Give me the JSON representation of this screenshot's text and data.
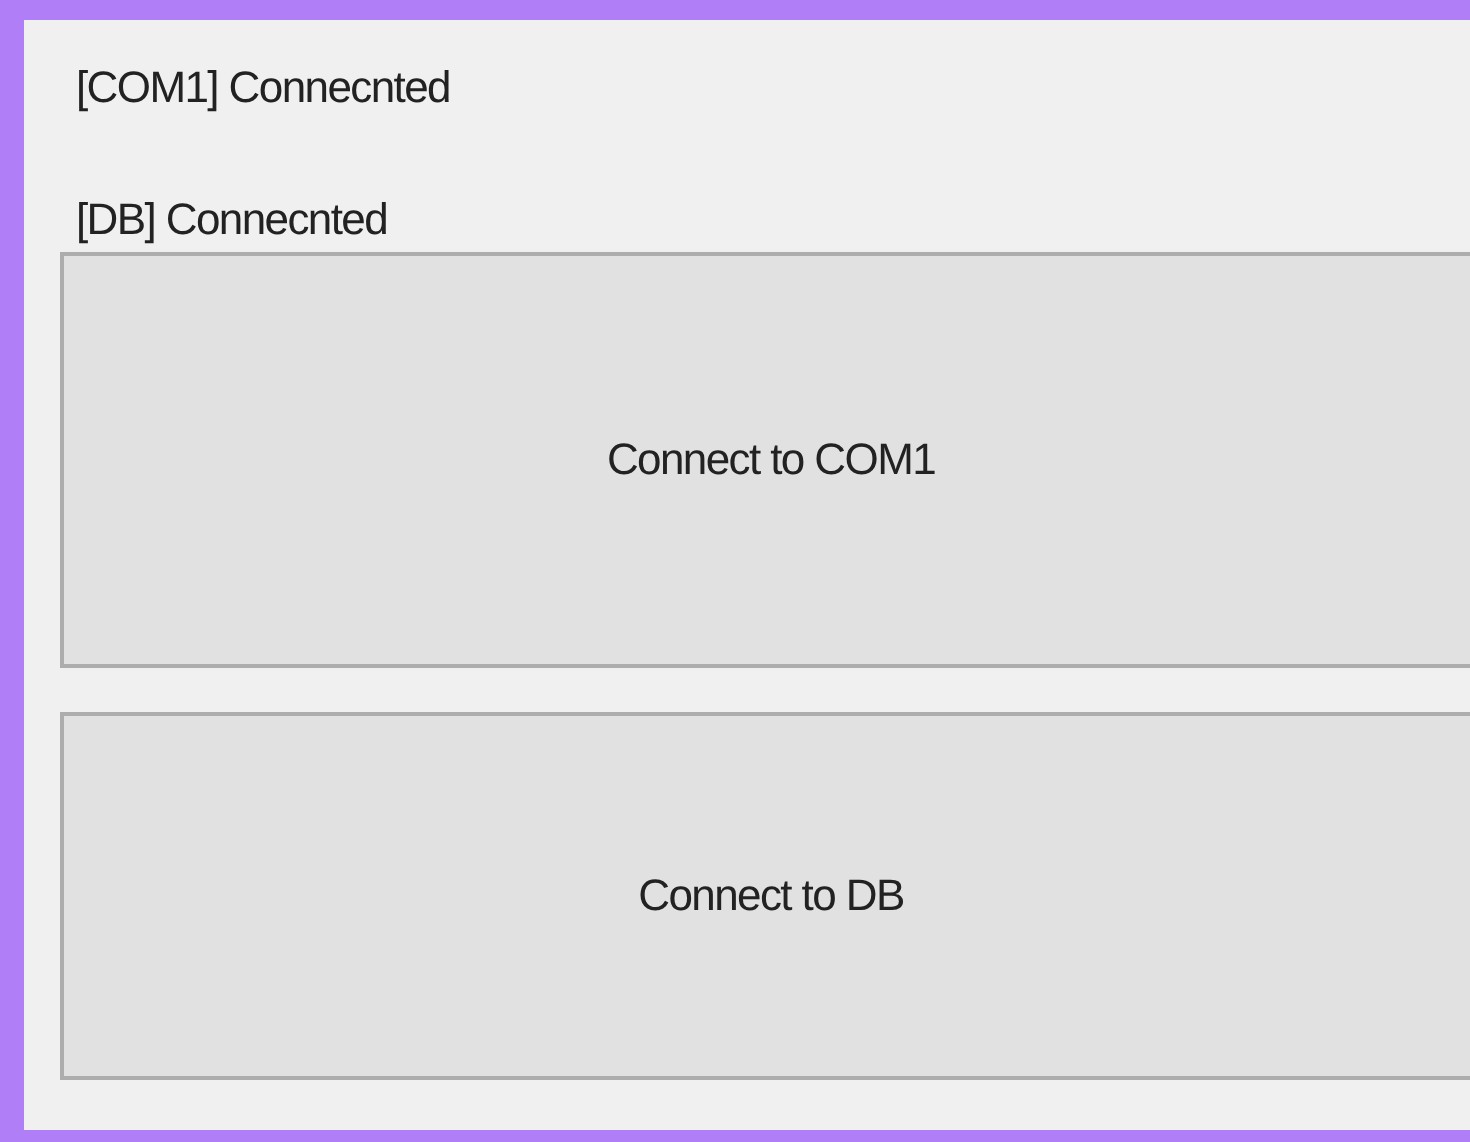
{
  "status_lines": [
    "[COM1] Connecnted",
    "[DB] Connecnted"
  ],
  "buttons": [
    "Connect to COM1",
    "Connect to DB"
  ]
}
